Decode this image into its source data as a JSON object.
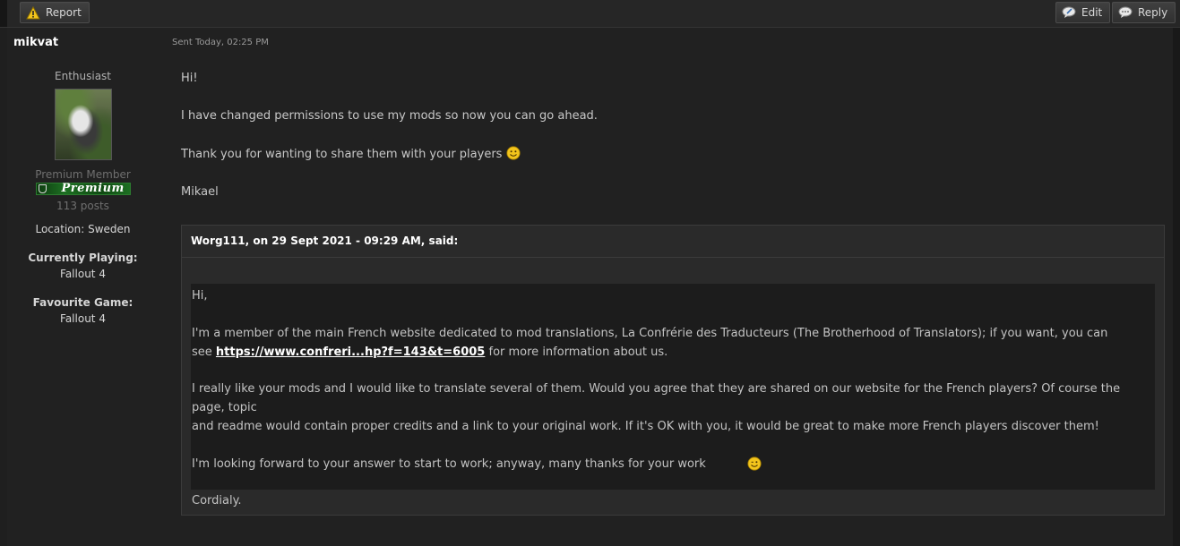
{
  "toolbar": {
    "report_label": "Report",
    "edit_label": "Edit",
    "reply_label": "Reply"
  },
  "post": {
    "author": "mikvat",
    "sent": "Sent Today, 02:25 PM",
    "body": {
      "p1": "Hi!",
      "p2": "I have changed permissions to use my mods so now you can go ahead.",
      "p3": "Thank you for wanting to share them with your players",
      "p4": "Mikael"
    }
  },
  "author_info": {
    "rank": "Enthusiast",
    "group": "Premium Member",
    "badge_text": "Premium",
    "posts": "113 posts",
    "location": "Location: Sweden",
    "currently_playing_label": "Currently Playing:",
    "currently_playing": "Fallout 4",
    "favourite_game_label": "Favourite Game:",
    "favourite_game": "Fallout 4"
  },
  "quote": {
    "citation": "Worg111, on 29 Sept 2021 - 09:29 AM, said:",
    "p1": "Hi,",
    "p2_line1": "I'm a member of the main French website dedicated to mod translations, La Confrérie des Traducteurs (The Brotherhood of Translators); if you want, you can",
    "p2_line2_pre": "see",
    "link_text": "https://www.confreri...hp?f=143&t=6005",
    "p2_line2_post": "for more information about us.",
    "p3_line1": "I really like your mods and I would like to translate several of them. Would you agree that they are shared on our website for the French players? Of course the page, topic",
    "p3_line2": "and readme would contain proper credits and a link to your original work. If it's OK with you, it would be great to make more French players discover them!",
    "p4": "I'm looking forward to your answer to start to work; anyway, many thanks for your work",
    "p5": "Cordialy."
  },
  "icons": {
    "report": "warning-icon",
    "edit": "edit-bubble-icon",
    "reply": "reply-bubble-icon",
    "smile": "smile-emoticon-icon",
    "wink": "wink-emoticon-icon"
  },
  "colors": {
    "emoticon": "#f2c41c",
    "badge": "#1d6f22"
  }
}
